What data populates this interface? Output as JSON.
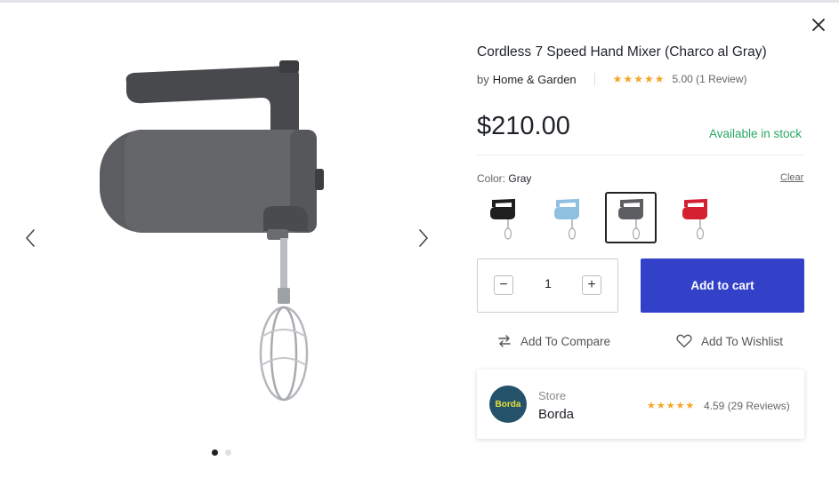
{
  "product": {
    "title": "Cordless 7 Speed Hand Mixer (Charco al Gray)",
    "by_prefix": "by",
    "brand": "Home & Garden",
    "stars": "★★★★★",
    "rating_text": "5.00 (1 Review)",
    "price": "$210.00",
    "stock_status": "Available in stock",
    "stock_color": "#2aa765"
  },
  "gallery": {
    "slide_count": 2,
    "active_slide": 1,
    "prev_icon": "chevron-left-icon",
    "next_icon": "chevron-right-icon"
  },
  "color": {
    "label": "Color:",
    "selected": "Gray",
    "clear_label": "Clear",
    "swatches": [
      {
        "name": "Black",
        "hex": "#1f1f1f",
        "selected": false
      },
      {
        "name": "Blue",
        "hex": "#8fc0e0",
        "selected": false
      },
      {
        "name": "Gray",
        "hex": "#5c5e62",
        "selected": true
      },
      {
        "name": "Red",
        "hex": "#d42030",
        "selected": false
      }
    ]
  },
  "quantity": {
    "value": "1",
    "minus_label": "−",
    "plus_label": "+"
  },
  "actions": {
    "add_to_cart": "Add to cart",
    "add_to_cart_color": "#3341c9",
    "compare_label": "Add To Compare",
    "wishlist_label": "Add To Wishlist"
  },
  "store": {
    "label": "Store",
    "name": "Borda",
    "avatar_text": "Borda",
    "stars": "★★★★★",
    "rating_text": "4.59 (29 Reviews)"
  }
}
